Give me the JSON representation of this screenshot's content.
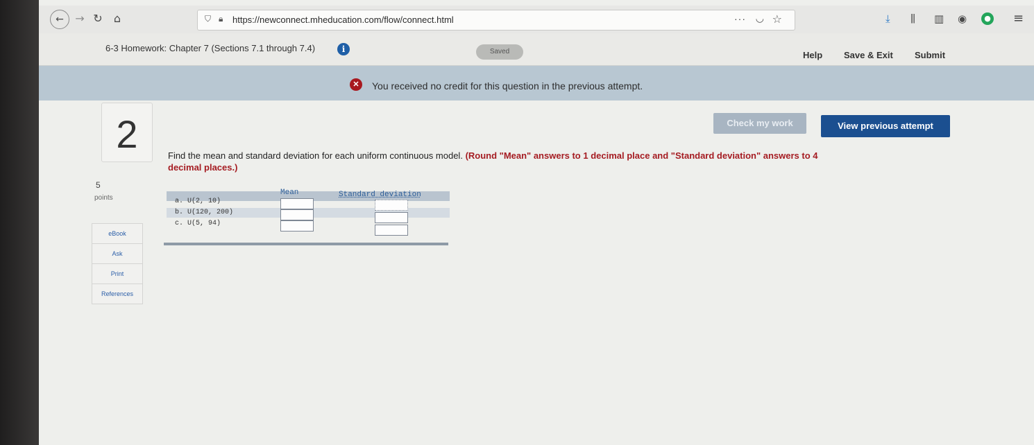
{
  "browser": {
    "url": "https://newconnect.mheducation.com/flow/connect.html",
    "more_label": "···"
  },
  "header": {
    "title": "6-3 Homework: Chapter 7 (Sections 7.1 through 7.4)",
    "saved_label": "Saved",
    "help_label": "Help",
    "save_exit_label": "Save & Exit",
    "submit_label": "Submit"
  },
  "banner": {
    "message": "You received no credit for this question in the previous attempt."
  },
  "question": {
    "number": "2",
    "points_value": "5",
    "points_label": "points",
    "prompt_plain": "Find the mean and standard deviation for each uniform continuous model.",
    "prompt_instruction": "(Round \"Mean\" answers to 1 decimal place and \"Standard deviation\" answers to 4 decimal places.)",
    "check_label": "Check my work",
    "view_previous_label": "View previous attempt"
  },
  "side_links": [
    "eBook",
    "Ask",
    "Print",
    "References"
  ],
  "answer_table": {
    "col_mean": "Mean",
    "col_sd": "Standard deviation",
    "rows": [
      {
        "label": "a. U(2, 10)",
        "mean": "",
        "sd": ""
      },
      {
        "label": "b. U(120, 200)",
        "mean": "",
        "sd": ""
      },
      {
        "label": "c. U(5, 94)",
        "mean": "",
        "sd": ""
      }
    ]
  },
  "colors": {
    "banner_bg": "#b8c7d2",
    "primary_button": "#1b4f90",
    "error_red": "#a51c22"
  }
}
